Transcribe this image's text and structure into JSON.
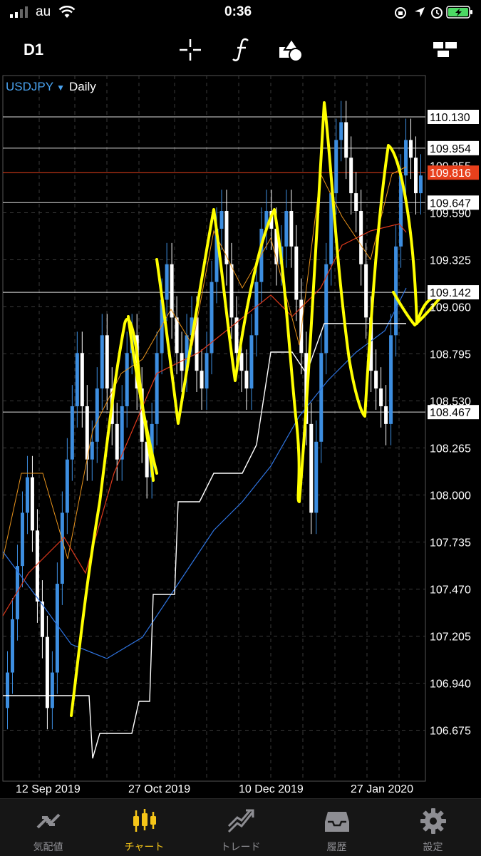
{
  "status": {
    "carrier": "au",
    "time": "0:36"
  },
  "toolbar": {
    "timeframe": "D1",
    "icons": [
      "crosshair-icon",
      "function-icon",
      "objects-icon",
      "windows-icon"
    ]
  },
  "chart": {
    "symbol": "USDJPY",
    "period": "Daily",
    "price_labels": [
      "110.130",
      "109.954",
      "109.855",
      "109.816",
      "109.647",
      "109.590",
      "109.325",
      "109.142",
      "109.060",
      "108.795",
      "108.530",
      "108.467",
      "108.265",
      "108.000",
      "107.735",
      "107.470",
      "107.205",
      "106.940",
      "106.675"
    ],
    "x_labels": [
      "12 Sep 2019",
      "27 Oct 2019",
      "10 Dec 2019",
      "27 Jan 2020"
    ],
    "current_price": "109.816",
    "colors": {
      "bull": "#3d8ee0",
      "bear": "#ffffff",
      "current_price": "#e8401c",
      "drawing": "#ffff00",
      "ma_fast": "#e8931c",
      "ma_mid": "#e03a1c",
      "ma_slow": "#2f74e0",
      "kijun": "#ffffff"
    }
  },
  "tabs": [
    {
      "label": "気配値",
      "icon": "quotes-icon"
    },
    {
      "label": "チャート",
      "icon": "chart-icon",
      "active": true
    },
    {
      "label": "トレード",
      "icon": "trade-icon"
    },
    {
      "label": "履歴",
      "icon": "history-icon"
    },
    {
      "label": "設定",
      "icon": "settings-icon"
    }
  ]
}
